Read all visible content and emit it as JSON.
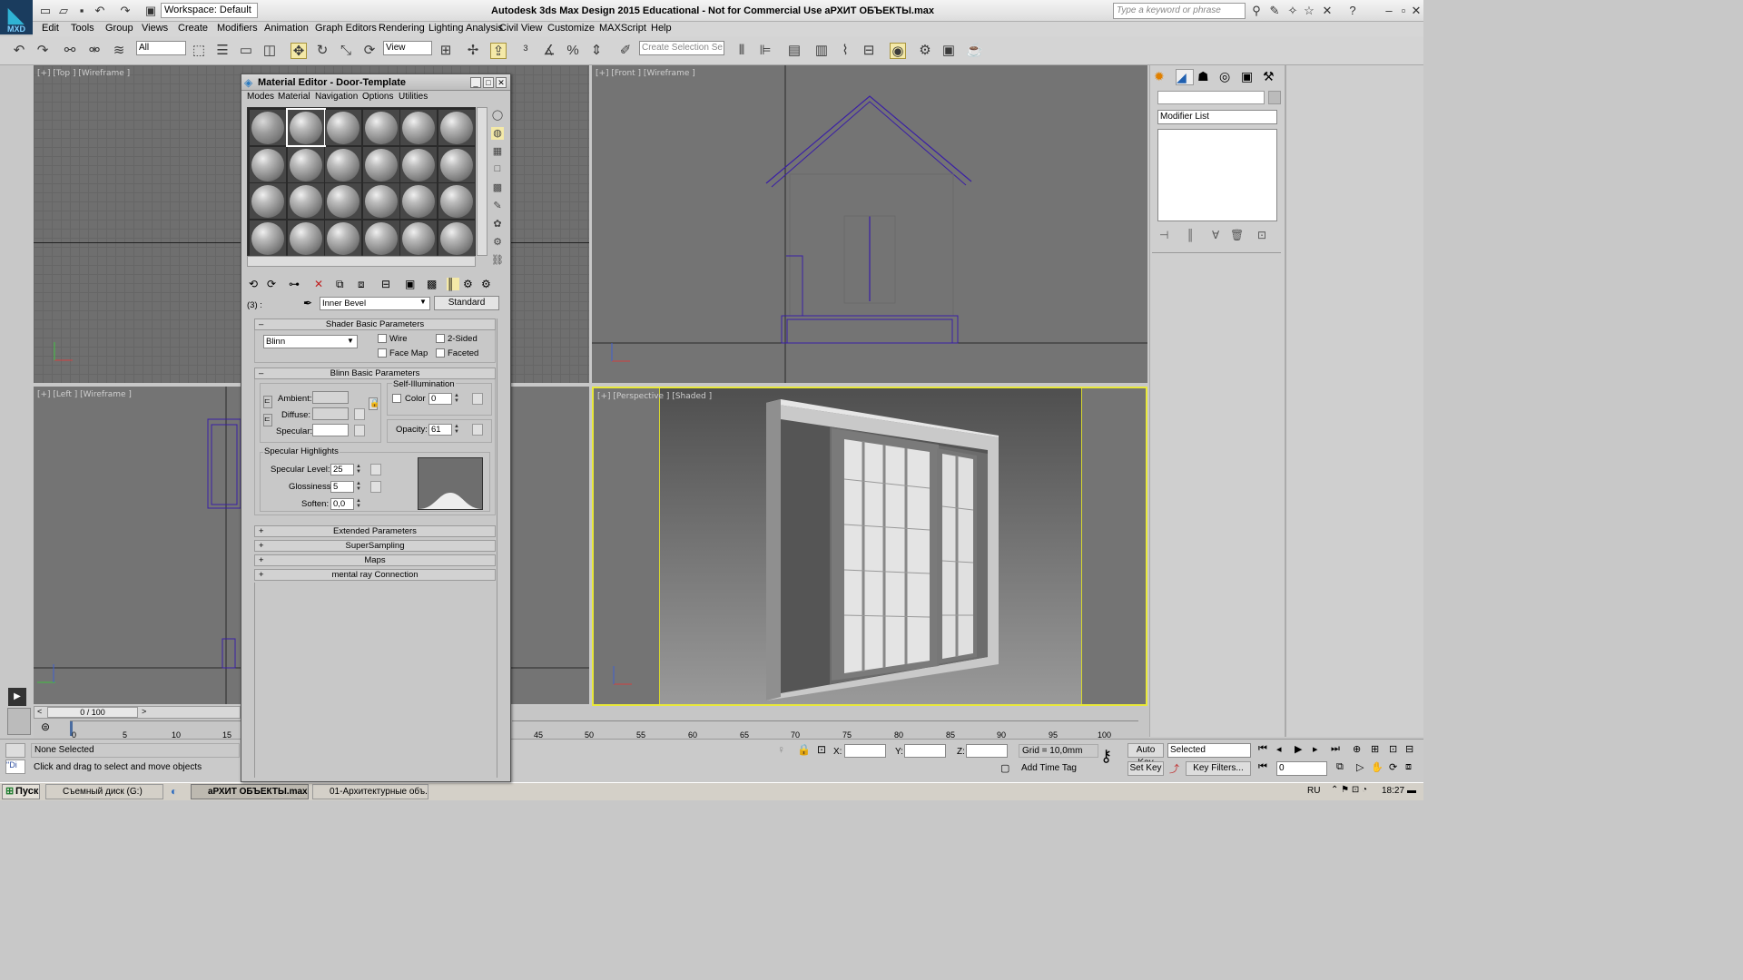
{
  "app": {
    "logo": "MXD",
    "title": "Autodesk 3ds Max Design 2015  Educational - Not for Commercial Use   аРХИТ ОБЪЕКТЫ.max",
    "workspace": "Workspace: Default",
    "search_placeholder": "Type a keyword or phrase"
  },
  "menu": [
    "Edit",
    "Tools",
    "Group",
    "Views",
    "Create",
    "Modifiers",
    "Animation",
    "Graph Editors",
    "Rendering",
    "Lighting Analysis",
    "Civil View",
    "Customize",
    "MAXScript",
    "Help"
  ],
  "toolbar": {
    "selection_filter": "All",
    "ref_coord": "View",
    "selection_set_placeholder": "Create Selection Se"
  },
  "viewports": {
    "top": "[+] [Top ] [Wireframe ]",
    "front": "[+] [Front ] [Wireframe ]",
    "left": "[+] [Left ] [Wireframe ]",
    "perspective_a": "[+] [Perspective ]",
    "perspective_b": "[Shaded ]"
  },
  "material_editor": {
    "title": "Material Editor - Door-Template",
    "menu": [
      "Modes",
      "Material",
      "Navigation",
      "Options",
      "Utilities"
    ],
    "slot_id": "(3) :",
    "material_name": "Inner Bevel",
    "material_type": "Standard",
    "shader_rollout": "Shader Basic Parameters",
    "shader": "Blinn",
    "wire": "Wire",
    "two_sided": "2-Sided",
    "face_map": "Face Map",
    "faceted": "Faceted",
    "blinn_rollout": "Blinn Basic Parameters",
    "self_illum": "Self-Illumination",
    "color_label": "Color",
    "color_value": "0",
    "ambient": "Ambient:",
    "diffuse": "Diffuse:",
    "specular": "Specular:",
    "opacity_label": "Opacity:",
    "opacity_value": "61",
    "spec_highlights": "Specular Highlights",
    "spec_level_label": "Specular Level:",
    "spec_level": "25",
    "gloss_label": "Glossiness:",
    "gloss": "5",
    "soften_label": "Soften:",
    "soften": "0,0",
    "rollouts": [
      "Extended Parameters",
      "SuperSampling",
      "Maps",
      "mental ray Connection"
    ],
    "colors": {
      "ambient": "#d4d4d4",
      "diffuse": "#d4d4d4",
      "specular": "#ffffff"
    }
  },
  "command_panel": {
    "modifier_list": "Modifier List"
  },
  "timeline": {
    "frame": "0 / 100",
    "ticks_left": [
      "0",
      "5",
      "10",
      "15"
    ],
    "ticks_right": [
      "45",
      "50",
      "55",
      "60",
      "65",
      "70",
      "75",
      "80",
      "85",
      "90",
      "95",
      "100"
    ]
  },
  "status": {
    "selection": "None Selected",
    "prompt": "Click and drag to select and move objects",
    "script_prompt": "\"Di",
    "x_label": "X:",
    "y_label": "Y:",
    "z_label": "Z:",
    "grid": "Grid = 10,0mm",
    "add_time_tag": "Add Time Tag",
    "auto_key": "Auto Key",
    "set_key": "Set Key",
    "key_filter_value": "Selected",
    "key_filters": "Key Filters...",
    "frame_field": "0"
  },
  "taskbar": {
    "start": "Пуск",
    "items": [
      "Съемный диск (G:)",
      "аРХИТ ОБЪЕКТЫ.max...",
      "01-Архитектурные объ..."
    ],
    "lang": "RU",
    "time": "18:27"
  }
}
